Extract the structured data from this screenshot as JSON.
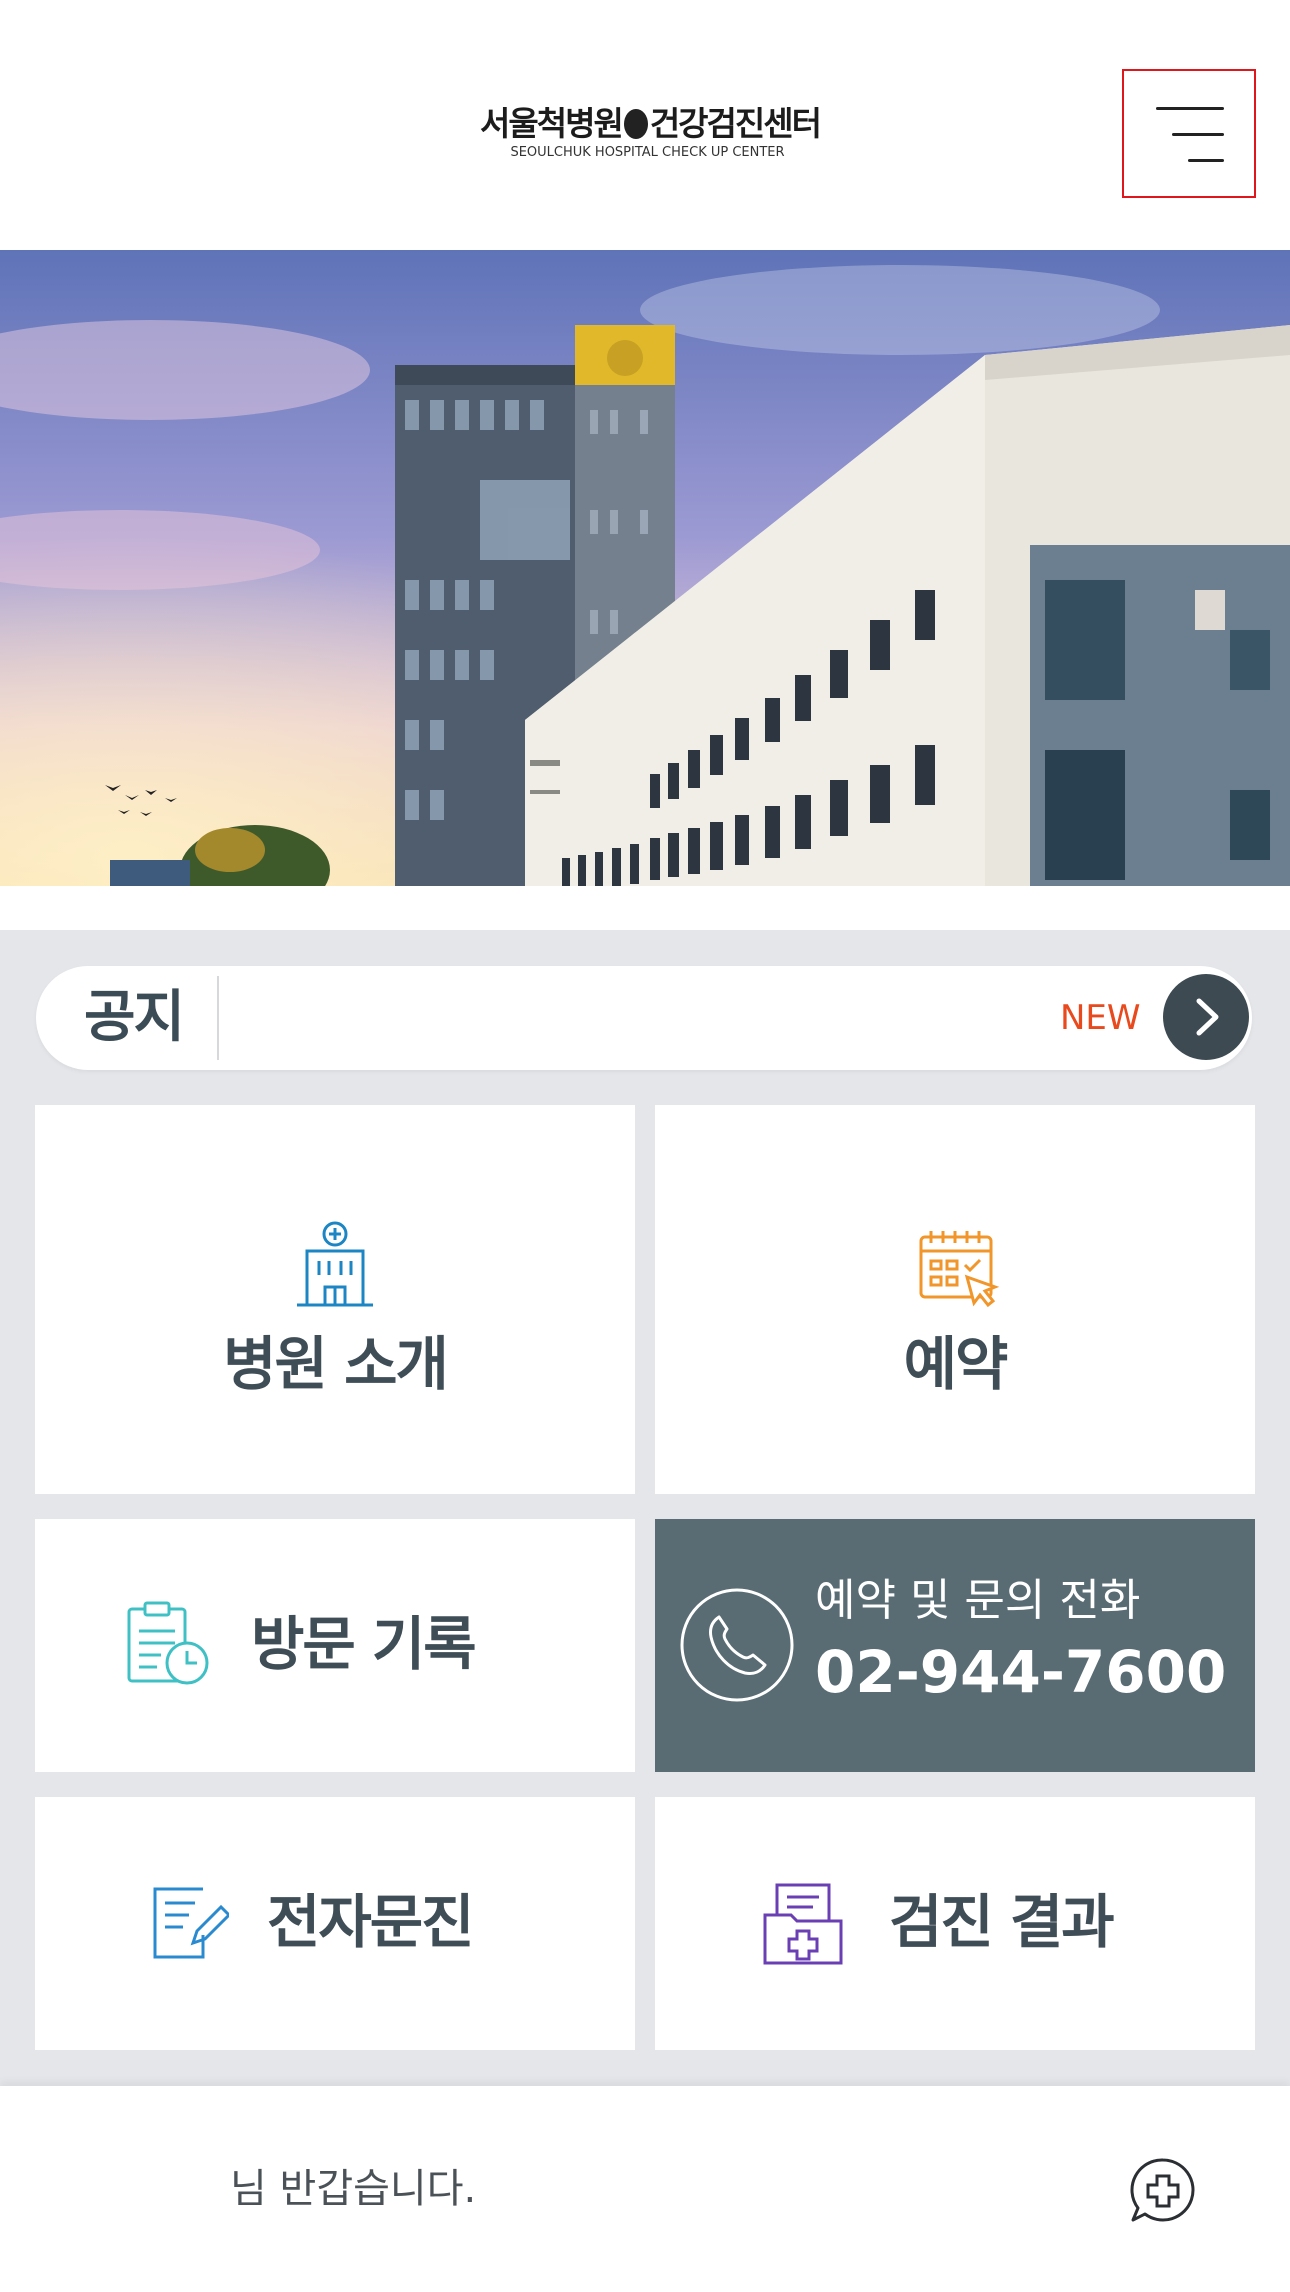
{
  "header": {
    "logo_title": "서울척병원",
    "logo_title_2": "건강검진센터",
    "logo_subtitle": "SEOULCHUK HOSPITAL CHECK UP CENTER",
    "menu_icon": "hamburger-menu-icon"
  },
  "notice": {
    "label": "공지",
    "new_badge": "NEW",
    "arrow_icon": "chevron-right-icon"
  },
  "tiles": {
    "hospital_intro": {
      "label": "병원 소개",
      "icon": "hospital-building-icon",
      "icon_color": "#1c86c4"
    },
    "reservation": {
      "label": "예약",
      "icon": "calendar-click-icon",
      "icon_color": "#f0962a"
    },
    "visit_record": {
      "label": "방문 기록",
      "icon": "clipboard-clock-icon",
      "icon_color": "#3fc0c4"
    },
    "phone": {
      "title": "예약 및 문의 전화",
      "number": "02-944-7600",
      "icon": "phone-icon",
      "bg_color": "#596b73"
    },
    "e_questionnaire": {
      "label": "전자문진",
      "icon": "document-pen-icon",
      "icon_color": "#2a8ad0"
    },
    "checkup_result": {
      "label": "검진 결과",
      "icon": "medical-folder-icon",
      "icon_color": "#6a3fb4"
    }
  },
  "footer": {
    "greeting": "님 반갑습니다.",
    "chat_icon": "chat-cross-icon"
  },
  "colors": {
    "accent_dark": "#3d4a52",
    "new_badge": "#e84a1d",
    "menu_highlight": "#e0161d",
    "background": "#e4e6ea"
  }
}
